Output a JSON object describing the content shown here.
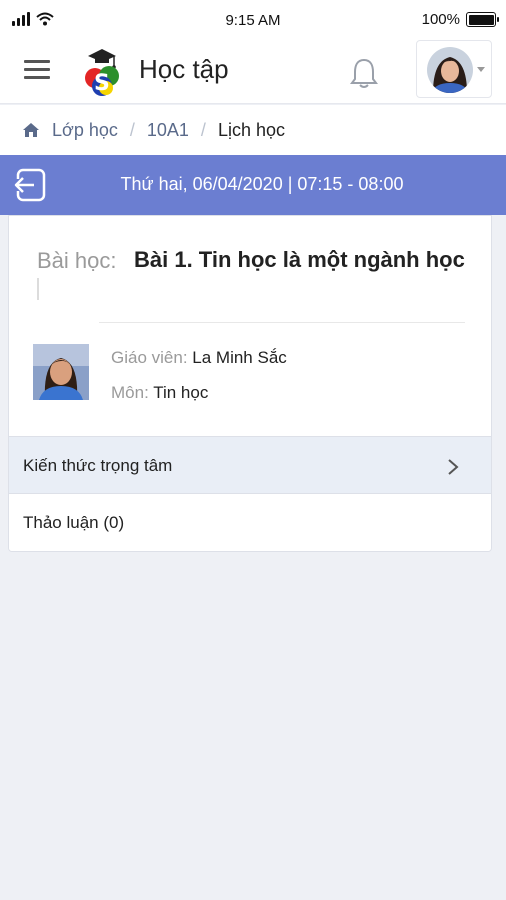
{
  "status_bar": {
    "time": "9:15 AM",
    "battery": "100%"
  },
  "header": {
    "app_title": "Học tập",
    "icons": {
      "menu": "hamburger-menu-icon",
      "logo": "graduation-cap-logo",
      "notification": "bell-icon",
      "avatar": "user-avatar"
    }
  },
  "breadcrumb": {
    "items": [
      "Lớp học",
      "10A1",
      "Lịch học"
    ],
    "separator": "/"
  },
  "schedule": {
    "datetime": "Thứ hai, 06/04/2020 | 07:15 - 08:00"
  },
  "lesson": {
    "prefix": "Bài học:",
    "title": "Bài 1. Tin học là một ngành học",
    "teacher_label": "Giáo viên:",
    "teacher_name": "La Minh Sắc",
    "subject_label": "Môn:",
    "subject_name": "Tin học"
  },
  "sections": [
    {
      "label": "Kiến thức trọng tâm"
    },
    {
      "label": "Thảo luận (0)"
    }
  ],
  "colors": {
    "accent": "#6b7ed1",
    "page_bg": "#eef0f5",
    "section_highlight": "#e9eef6"
  }
}
